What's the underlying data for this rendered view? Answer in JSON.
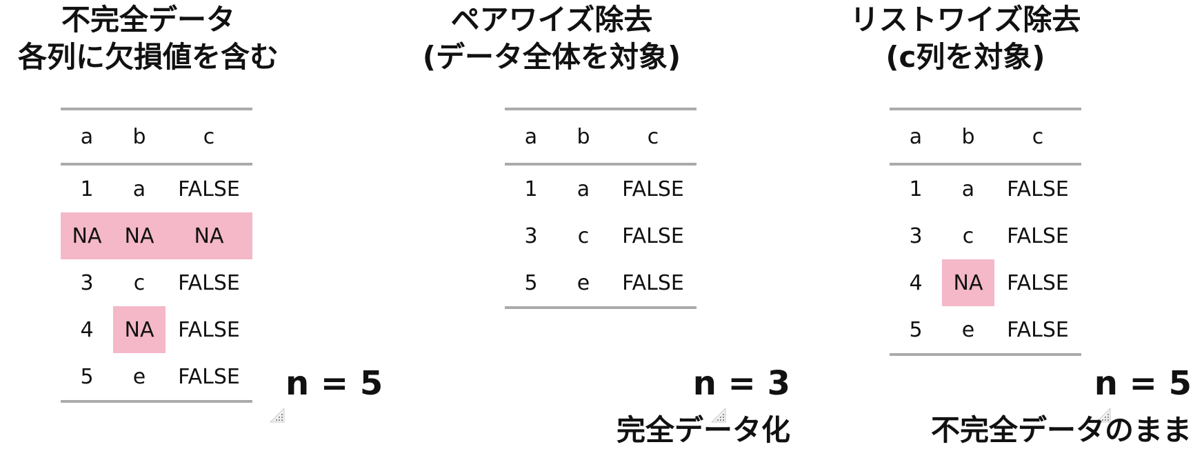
{
  "panels": [
    {
      "id": "incomplete",
      "title_line1": "不完全データ",
      "title_line2": "各列に欠損値を含む",
      "columns": [
        "a",
        "b",
        "c"
      ],
      "rows": [
        [
          "1",
          "a",
          "FALSE"
        ],
        [
          "NA",
          "NA",
          "NA"
        ],
        [
          "3",
          "c",
          "FALSE"
        ],
        [
          "4",
          "NA",
          "FALSE"
        ],
        [
          "5",
          "e",
          "FALSE"
        ]
      ],
      "n_label": "n = 5",
      "subtitle": ""
    },
    {
      "id": "pairwise",
      "title_line1": "ペアワイズ除去",
      "title_line2": "(データ全体を対象)",
      "columns": [
        "a",
        "b",
        "c"
      ],
      "rows": [
        [
          "1",
          "a",
          "FALSE"
        ],
        [
          "3",
          "c",
          "FALSE"
        ],
        [
          "5",
          "e",
          "FALSE"
        ]
      ],
      "n_label": "n = 3",
      "subtitle": "完全データ化"
    },
    {
      "id": "listwise",
      "title_line1": "リストワイズ除去",
      "title_line2": "(c列を対象)",
      "columns": [
        "a",
        "b",
        "c"
      ],
      "rows": [
        [
          "1",
          "a",
          "FALSE"
        ],
        [
          "3",
          "c",
          "FALSE"
        ],
        [
          "4",
          "NA",
          "FALSE"
        ],
        [
          "5",
          "e",
          "FALSE"
        ]
      ],
      "n_label": "n = 5",
      "subtitle": "不完全データのまま"
    }
  ],
  "highlight_value": "NA",
  "colors": {
    "na_fill": "#f4b8c8",
    "rule": "#aaaaaa",
    "text": "#111111"
  },
  "icons": {
    "corner": "resize-handle-icon"
  }
}
